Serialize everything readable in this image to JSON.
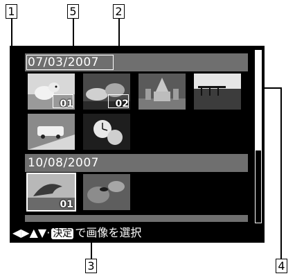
{
  "callouts": {
    "c1": "1",
    "c2": "2",
    "c3": "3",
    "c4": "4",
    "c5": "5"
  },
  "screen": {
    "groups": [
      {
        "date": "07/03/2007",
        "thumbs": [
          "01",
          "02",
          "",
          "",
          "",
          ""
        ]
      },
      {
        "date": "10/08/2007",
        "thumbs": [
          "01",
          ""
        ]
      }
    ],
    "footer": {
      "arrows": "◀▶▲▼·",
      "key_label": "決定",
      "text": "で画像を選択"
    },
    "scroll_position": 0.0,
    "colors": {
      "screen_bg": "#000000",
      "date_bar_bg": "#6f6f6f",
      "text": "#ffffff"
    }
  }
}
